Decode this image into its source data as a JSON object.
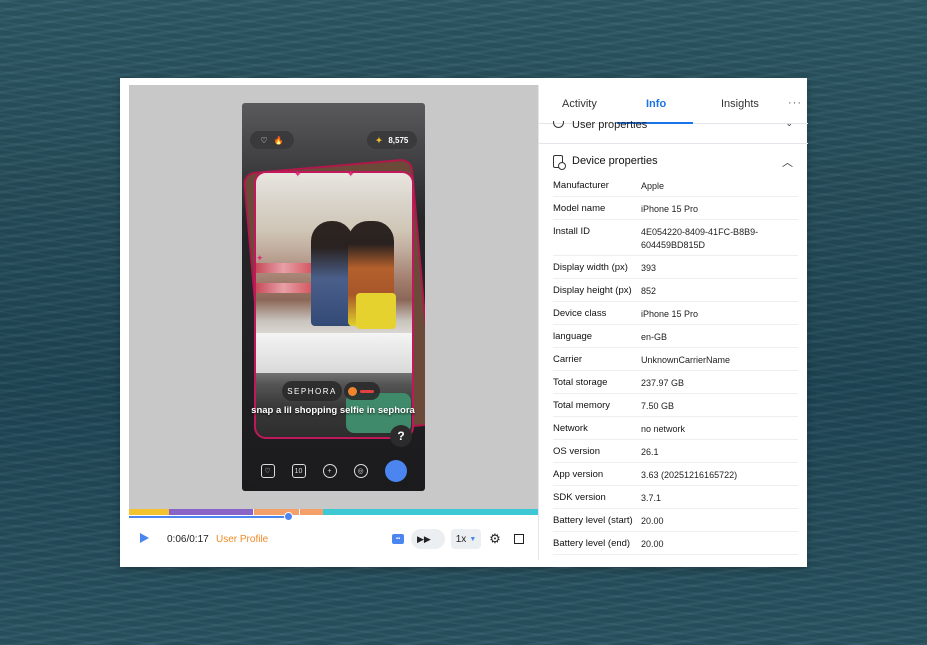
{
  "player": {
    "caption": "snap a lil shopping selfie in sephora",
    "brand_tag": "SEPHORA",
    "points": "8,575",
    "points_icon": "sparkle-icon",
    "help_label": "?",
    "bottom_tab_badge": "10",
    "time": "0:06/0:17",
    "user_profile_label": "User Profile",
    "speed": "1x",
    "timeline_colors": [
      "#f4c430",
      "#8a63c6",
      "#f4a06a",
      "#3cc8d4"
    ]
  },
  "panel": {
    "tabs": [
      {
        "label": "Activity"
      },
      {
        "label": "Info",
        "active": true
      },
      {
        "label": "Insights"
      }
    ],
    "more_label": "···",
    "user_section_title": "User properties",
    "device_section_title": "Device properties",
    "device_properties": [
      {
        "key": "Manufacturer",
        "value": "Apple"
      },
      {
        "key": "Model name",
        "value": "iPhone 15 Pro"
      },
      {
        "key": "Install ID",
        "value": "4E054220-8409-41FC-B8B9-604459BD815D"
      },
      {
        "key": "Display width (px)",
        "value": "393"
      },
      {
        "key": "Display height (px)",
        "value": "852"
      },
      {
        "key": "Device class",
        "value": "iPhone 15 Pro"
      },
      {
        "key": "language",
        "value": "en-GB"
      },
      {
        "key": "Carrier",
        "value": "UnknownCarrierName"
      },
      {
        "key": "Total storage",
        "value": "237.97 GB"
      },
      {
        "key": "Total memory",
        "value": "7.50 GB"
      },
      {
        "key": "Network",
        "value": "no network"
      },
      {
        "key": "OS version",
        "value": "26.1"
      },
      {
        "key": "App version",
        "value": "3.63 (20251216165722)"
      },
      {
        "key": "SDK version",
        "value": "3.7.1"
      },
      {
        "key": "Battery level (start)",
        "value": "20.00"
      },
      {
        "key": "Battery level (end)",
        "value": "20.00"
      }
    ]
  },
  "colors": {
    "accent": "#1a73e8",
    "player_accent": "#4b86f0",
    "user_profile": "#f08a24"
  }
}
